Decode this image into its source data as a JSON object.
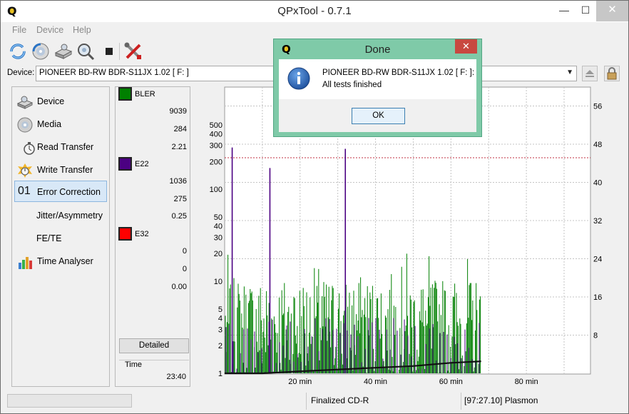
{
  "window": {
    "title": "QPxTool - 0.7.1",
    "minimize": "—",
    "maximize": "☐",
    "close": "✕"
  },
  "menu": [
    "File",
    "Device",
    "Help"
  ],
  "toolbar": {
    "icons": [
      "refresh-icon",
      "disc-scan-icon",
      "device-info-icon",
      "zoom-icon",
      "stop-icon",
      "tools-icon"
    ]
  },
  "device": {
    "label": "Device:",
    "value": "PIONEER  BD-RW  BDR-S11JX 1.02 [ F: ]"
  },
  "nav": [
    {
      "label": "Device",
      "icon": "drive-icon"
    },
    {
      "label": "Media",
      "icon": "disc-icon"
    },
    {
      "label": "Read Transfer",
      "icon": "stopwatch-icon"
    },
    {
      "label": "Write Transfer",
      "icon": "stopwatch-burst-icon"
    },
    {
      "label": "Error Correction",
      "num": "01",
      "active": true
    },
    {
      "label": "Jitter/Asymmetry"
    },
    {
      "label": "FE/TE"
    },
    {
      "label": "Time Analyser",
      "icon": "bar-chart-icon"
    }
  ],
  "legend": {
    "bler": {
      "name": "BLER",
      "color": "#008000",
      "total": "9039",
      "max": "284",
      "avg": "2.21"
    },
    "e22": {
      "name": "E22",
      "color": "#4b0082",
      "total": "1036",
      "max": "275",
      "avg": "0.25"
    },
    "e32": {
      "name": "E32",
      "color": "#ff0000",
      "total": "0",
      "max": "0",
      "avg": "0.00"
    },
    "detailed": "Detailed",
    "time_label": "Time",
    "time_value": "23:40"
  },
  "chart_data": {
    "type": "bar",
    "y_scale": "log",
    "left_ticks": [
      "1",
      "2",
      "3",
      "4",
      "5",
      "10",
      "20",
      "30",
      "40",
      "50",
      "100",
      "200",
      "300",
      "400",
      "500"
    ],
    "right_ticks": [
      "8",
      "16",
      "24",
      "32",
      "40",
      "48",
      "56"
    ],
    "x_ticks": [
      "20 min",
      "40 min",
      "60 min",
      "80 min"
    ],
    "xlim_min": [
      0,
      97
    ],
    "data_end_min": 68,
    "reference_line": 220,
    "series": [
      {
        "name": "BLER",
        "color": "#008000",
        "max": 284
      },
      {
        "name": "E22",
        "color": "#4b0082",
        "max": 275
      },
      {
        "name": "E32",
        "color": "#ff0000",
        "max": 0
      }
    ],
    "spikes": [
      {
        "x_min": 2,
        "value": 284
      },
      {
        "x_min": 12,
        "value": 170
      },
      {
        "x_min": 32,
        "value": 275
      }
    ],
    "speed_curve": [
      [
        0,
        1
      ],
      [
        10,
        1
      ],
      [
        20,
        1.05
      ],
      [
        30,
        1.1
      ],
      [
        40,
        1.15
      ],
      [
        50,
        1.2
      ],
      [
        60,
        1.3
      ],
      [
        68,
        1.35
      ]
    ]
  },
  "status": {
    "left": "",
    "middle": "Finalized CD-R",
    "right": "[97:27.10] Plasmon"
  },
  "dialog": {
    "title": "Done",
    "line1": "PIONEER  BD-RW  BDR-S11JX 1.02 [ F: ]:",
    "line2": "All tests finished",
    "ok": "OK",
    "close": "✕"
  }
}
